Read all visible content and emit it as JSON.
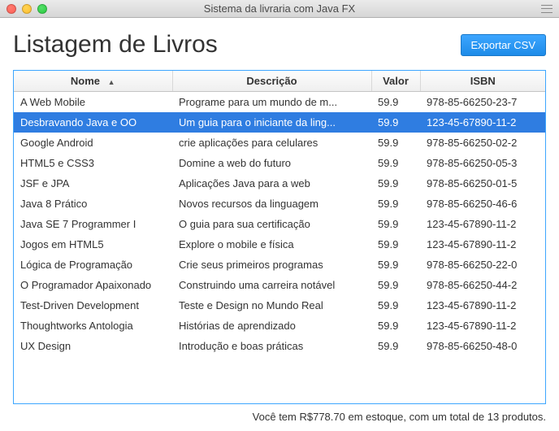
{
  "window": {
    "title": "Sistema da livraria com Java FX"
  },
  "page": {
    "title": "Listagem de Livros",
    "export_label": "Exportar CSV"
  },
  "table": {
    "headers": {
      "nome": "Nome",
      "descricao": "Descrição",
      "valor": "Valor",
      "isbn": "ISBN"
    },
    "sort_indicator": "▲",
    "rows": [
      {
        "nome": "A Web Mobile",
        "desc": "Programe para um mundo de m...",
        "valor": "59.9",
        "isbn": "978-85-66250-23-7",
        "selected": false
      },
      {
        "nome": "Desbravando Java e OO",
        "desc": "Um guia para o iniciante da ling...",
        "valor": "59.9",
        "isbn": "123-45-67890-11-2",
        "selected": true
      },
      {
        "nome": "Google Android",
        "desc": "crie aplicações para celulares",
        "valor": "59.9",
        "isbn": "978-85-66250-02-2",
        "selected": false
      },
      {
        "nome": "HTML5 e CSS3",
        "desc": "Domine a web do futuro",
        "valor": "59.9",
        "isbn": "978-85-66250-05-3",
        "selected": false
      },
      {
        "nome": "JSF e JPA",
        "desc": "Aplicações Java para a web",
        "valor": "59.9",
        "isbn": "978-85-66250-01-5",
        "selected": false
      },
      {
        "nome": "Java 8 Prático",
        "desc": "Novos recursos da linguagem",
        "valor": "59.9",
        "isbn": "978-85-66250-46-6",
        "selected": false
      },
      {
        "nome": "Java SE 7 Programmer I",
        "desc": "O guia para sua certificação",
        "valor": "59.9",
        "isbn": "123-45-67890-11-2",
        "selected": false
      },
      {
        "nome": "Jogos em HTML5",
        "desc": "Explore o mobile e física",
        "valor": "59.9",
        "isbn": "123-45-67890-11-2",
        "selected": false
      },
      {
        "nome": "Lógica de Programação",
        "desc": "Crie seus primeiros programas",
        "valor": "59.9",
        "isbn": "978-85-66250-22-0",
        "selected": false
      },
      {
        "nome": "O Programador Apaixonado",
        "desc": "Construindo uma carreira notável",
        "valor": "59.9",
        "isbn": "978-85-66250-44-2",
        "selected": false
      },
      {
        "nome": "Test-Driven Development",
        "desc": "Teste e Design no Mundo Real",
        "valor": "59.9",
        "isbn": "123-45-67890-11-2",
        "selected": false
      },
      {
        "nome": "Thoughtworks Antologia",
        "desc": "Histórias de aprendizado",
        "valor": "59.9",
        "isbn": "123-45-67890-11-2",
        "selected": false
      },
      {
        "nome": "UX Design",
        "desc": "Introdução e boas práticas",
        "valor": "59.9",
        "isbn": "978-85-66250-48-0",
        "selected": false
      }
    ]
  },
  "footer": {
    "text": "Você tem R$778.70 em estoque, com um total de 13 produtos."
  }
}
